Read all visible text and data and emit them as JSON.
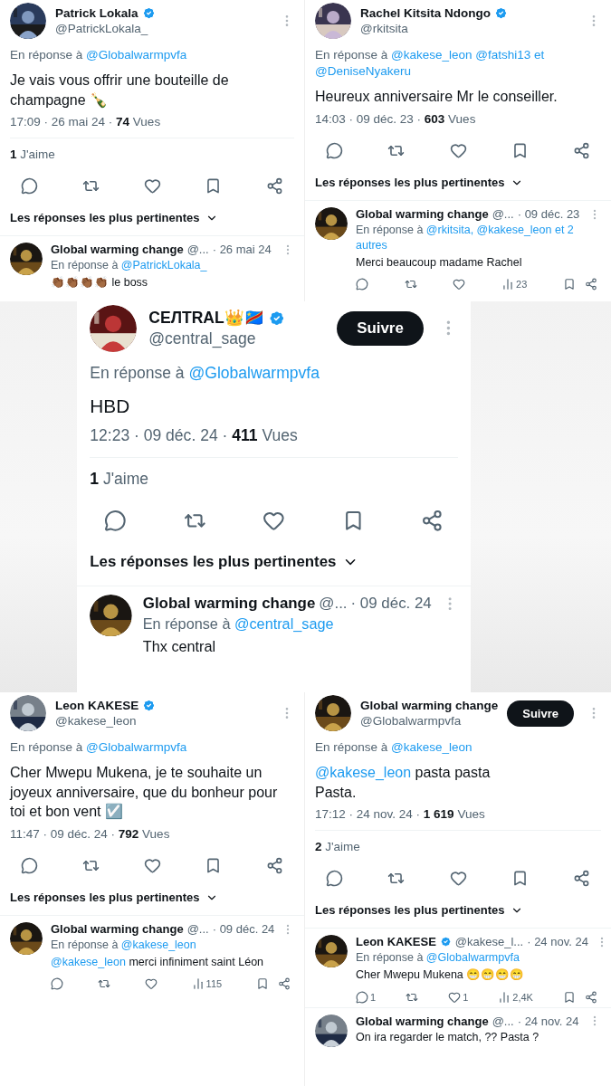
{
  "panels": [
    {
      "author": {
        "name": "Patrick Lokala",
        "handle": "@PatrickLokala_",
        "verified": true
      },
      "reply_prefix": "En réponse à",
      "reply_to": "@Globalwarmpvfa",
      "body": [
        {
          "kind": "text",
          "text": "Je vais vous offrir une bouteille de champagne 🍾"
        }
      ],
      "meta": "17:09 · 26 mai 24 · **74** Vues",
      "likes": "**1** J'aime",
      "sort_label": "Les réponses les plus pertinentes",
      "replies": [
        {
          "name": "Global warming change",
          "verified": false,
          "handle": "@...",
          "date": "· 26 mai 24",
          "reply_prefix": "En réponse à",
          "reply_to": "@PatrickLokala_",
          "body": [
            {
              "kind": "text",
              "text": "👏🏾👏🏾👏🏾👏🏾 le boss"
            }
          ]
        }
      ]
    },
    {
      "author": {
        "name": "Rachel Kitsita Ndongo",
        "handle": "@rkitsita",
        "verified": true
      },
      "reply_prefix": "En réponse à",
      "reply_to": "@kakese_leon @fatshi13 et @DeniseNyakeru",
      "body": [
        {
          "kind": "text",
          "text": "Heureux anniversaire Mr le conseiller."
        }
      ],
      "meta": "14:03 · 09 déc. 23 · **603** Vues",
      "sort_label": "Les réponses les plus pertinentes",
      "replies": [
        {
          "name": "Global warming change",
          "verified": false,
          "handle": "@...",
          "date": "· 09 déc. 23",
          "reply_prefix": "En réponse à",
          "reply_to": "@rkitsita, @kakese_leon et 2 autres",
          "body": [
            {
              "kind": "text",
              "text": "Merci beaucoup madame Rachel"
            }
          ],
          "stats": {
            "views": "23"
          }
        }
      ]
    },
    {
      "author": {
        "name": "CEЛTRAL👑🇨🇩",
        "handle": "@central_sage",
        "verified": true
      },
      "follow_button": "Suivre",
      "reply_prefix": "En réponse à",
      "reply_to": "@Globalwarmpvfa",
      "body": [
        {
          "kind": "text",
          "text": "HBD"
        }
      ],
      "meta": "12:23 · 09 déc. 24 · **411** Vues",
      "likes": "**1** J'aime",
      "sort_label": "Les réponses les plus pertinentes",
      "replies": [
        {
          "name": "Global warming change",
          "verified": false,
          "handle": "@...",
          "date": "· 09 déc. 24",
          "reply_prefix": "En réponse à",
          "reply_to": "@central_sage",
          "body": [
            {
              "kind": "text",
              "text": "Thx central"
            }
          ]
        }
      ]
    },
    {
      "author": {
        "name": "Leon KAKESE",
        "handle": "@kakese_leon",
        "verified": true
      },
      "reply_prefix": "En réponse à",
      "reply_to": "@Globalwarmpvfa",
      "body": [
        {
          "kind": "text",
          "text": "Cher Mwepu Mukena, je te souhaite un joyeux anniversaire, que du bonheur pour toi et bon vent ☑️"
        }
      ],
      "meta": "11:47 · 09 déc. 24 · **792** Vues",
      "sort_label": "Les réponses les plus pertinentes",
      "replies": [
        {
          "name": "Global warming change",
          "verified": false,
          "handle": "@...",
          "date": "· 09 déc. 24",
          "reply_prefix": "En réponse à",
          "reply_to": "@kakese_leon",
          "body": [
            {
              "kind": "mention",
              "text": "@kakese_leon"
            },
            {
              "kind": "text",
              "text": "merci infiniment  saint Léon"
            }
          ],
          "stats": {
            "views": "115"
          }
        }
      ]
    },
    {
      "author": {
        "name": "Global warming change",
        "handle": "@Globalwarmpvfa"
      },
      "follow_button": "Suivre",
      "reply_prefix": "En réponse à",
      "reply_to": "@kakese_leon",
      "body": [
        {
          "kind": "mention",
          "text": "@kakese_leon"
        },
        {
          "kind": "text",
          "text": "pasta pasta"
        },
        {
          "kind": "break"
        },
        {
          "kind": "text",
          "text": "Pasta."
        }
      ],
      "meta": "17:12 · 24 nov. 24 · **1 619** Vues",
      "likes": "**2** J'aime",
      "sort_label": "Les réponses les plus pertinentes",
      "replies": [
        {
          "name": "Leon KAKESE",
          "verified": true,
          "handle": "@kakese_l...",
          "date": "· 24 nov. 24",
          "reply_prefix": "En réponse à",
          "reply_to": "@Globalwarmpvfa",
          "body": [
            {
              "kind": "text",
              "text": "Cher Mwepu Mukena 😁😁😁😁"
            }
          ],
          "stats": {
            "replies": "1",
            "likes": "1",
            "views": "2,4K"
          }
        },
        {
          "name": "Global warming change",
          "verified": false,
          "handle": "@...",
          "date": "· 24 nov. 24",
          "body": [
            {
              "kind": "text",
              "text": "On ira regarder le match, ?? Pasta ?"
            }
          ]
        }
      ]
    }
  ]
}
